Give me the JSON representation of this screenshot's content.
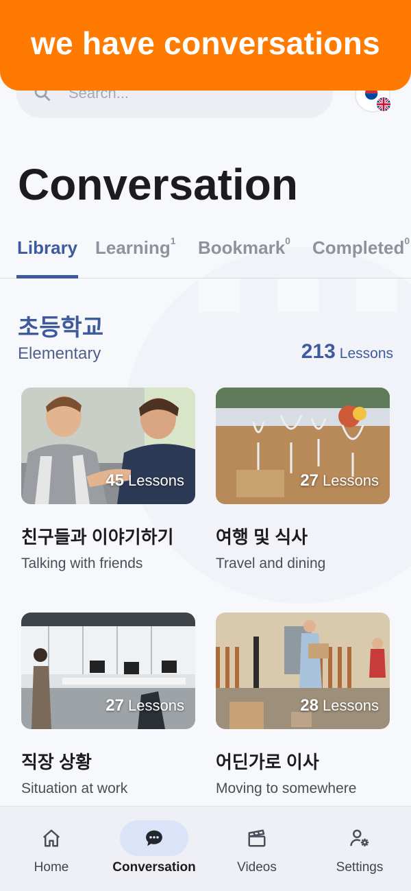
{
  "banner": {
    "text": "we have conversations"
  },
  "search": {
    "placeholder": "Search..."
  },
  "header": {
    "title": "Conversation"
  },
  "tabs": [
    {
      "label": "Library",
      "count": "",
      "active": true
    },
    {
      "label": "Learning",
      "count": "1",
      "active": false
    },
    {
      "label": "Bookmark",
      "count": "0",
      "active": false
    },
    {
      "label": "Completed",
      "count": "0",
      "active": false
    }
  ],
  "section": {
    "title_ko": "초등학교",
    "title_en": "Elementary",
    "lesson_count": "213",
    "lesson_label": "Lessons"
  },
  "cards": [
    {
      "lessons": "45",
      "lessons_label": "Lessons",
      "title_ko": "친구들과 이야기하기",
      "title_en": "Talking with friends"
    },
    {
      "lessons": "27",
      "lessons_label": "Lessons",
      "title_ko": "여행 및 식사",
      "title_en": "Travel and dining"
    },
    {
      "lessons": "27",
      "lessons_label": "Lessons",
      "title_ko": "직장 상황",
      "title_en": "Situation at work"
    },
    {
      "lessons": "28",
      "lessons_label": "Lessons",
      "title_ko": "어딘가로 이사",
      "title_en": "Moving to somewhere"
    }
  ],
  "nav": [
    {
      "label": "Home",
      "icon": "home-icon",
      "active": false
    },
    {
      "label": "Conversation",
      "icon": "chat-icon",
      "active": true
    },
    {
      "label": "Videos",
      "icon": "clapperboard-icon",
      "active": false
    },
    {
      "label": "Settings",
      "icon": "user-settings-icon",
      "active": false
    }
  ],
  "colors": {
    "banner": "#ff7a00",
    "accent": "#3d5a9c",
    "nav_active_pill": "#dbe3f8",
    "background": "#f7f8fc"
  }
}
